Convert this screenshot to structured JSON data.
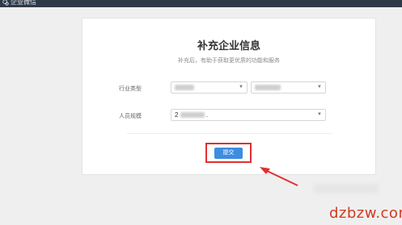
{
  "window": {
    "brand": "企业微信"
  },
  "form": {
    "title": "补充企业信息",
    "subtitle": "补充后，有助于获取更优质的功能和服务",
    "industry": {
      "label": "行业类型",
      "primary_value": "",
      "secondary_value": ""
    },
    "size": {
      "label": "人员规模",
      "value": "2",
      "suffix": "."
    },
    "submit_label": "提交"
  },
  "watermark": "dzbzw.com",
  "colors": {
    "topbar": "#2e3a48",
    "primary": "#3d8ce0",
    "highlight": "#e0302e",
    "watermark": "#d33a1f"
  }
}
